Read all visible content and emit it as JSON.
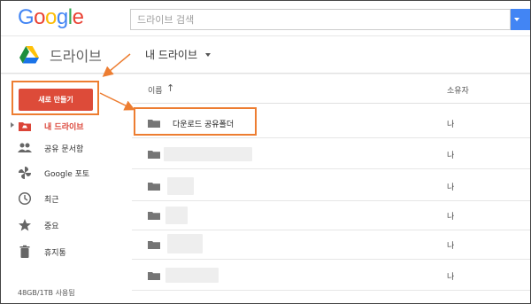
{
  "header": {
    "logo_letters": [
      {
        "char": "G",
        "color": "#4285f4"
      },
      {
        "char": "o",
        "color": "#ea4335"
      },
      {
        "char": "o",
        "color": "#fbbc05"
      },
      {
        "char": "g",
        "color": "#4285f4"
      },
      {
        "char": "l",
        "color": "#34a853"
      },
      {
        "char": "e",
        "color": "#ea4335"
      }
    ],
    "search_placeholder": "드라이브 검색",
    "search_button_color": "#4285f4"
  },
  "subbar": {
    "app_title": "드라이브",
    "breadcrumb": "내 드라이브"
  },
  "sidebar": {
    "new_button_label": "새로 만들기",
    "new_button_color": "#dd4b39",
    "items": [
      {
        "label": "내 드라이브",
        "icon": "my-drive-icon",
        "active": true
      },
      {
        "label": "공유 문서함",
        "icon": "people-icon",
        "active": false
      },
      {
        "label": "Google 포토",
        "icon": "photos-pinwheel-icon",
        "active": false
      },
      {
        "label": "최근",
        "icon": "clock-icon",
        "active": false
      },
      {
        "label": "중요",
        "icon": "star-icon",
        "active": false
      },
      {
        "label": "휴지통",
        "icon": "trash-icon",
        "active": false
      }
    ],
    "storage": "48GB/1TB 사용됨"
  },
  "file_list": {
    "col_name": "이름",
    "col_owner": "소유자",
    "sort_icon": "arrow-up-icon",
    "rows": [
      {
        "name": "다운로드 공유폴더",
        "owner": "나",
        "redacted": false
      },
      {
        "name": "",
        "owner": "나",
        "redacted": true
      },
      {
        "name": "",
        "owner": "나",
        "redacted": true
      },
      {
        "name": "",
        "owner": "나",
        "redacted": true
      },
      {
        "name": "",
        "owner": "나",
        "redacted": true
      },
      {
        "name": "",
        "owner": "나",
        "redacted": true
      }
    ]
  },
  "annotation_color": "#ed7d31"
}
